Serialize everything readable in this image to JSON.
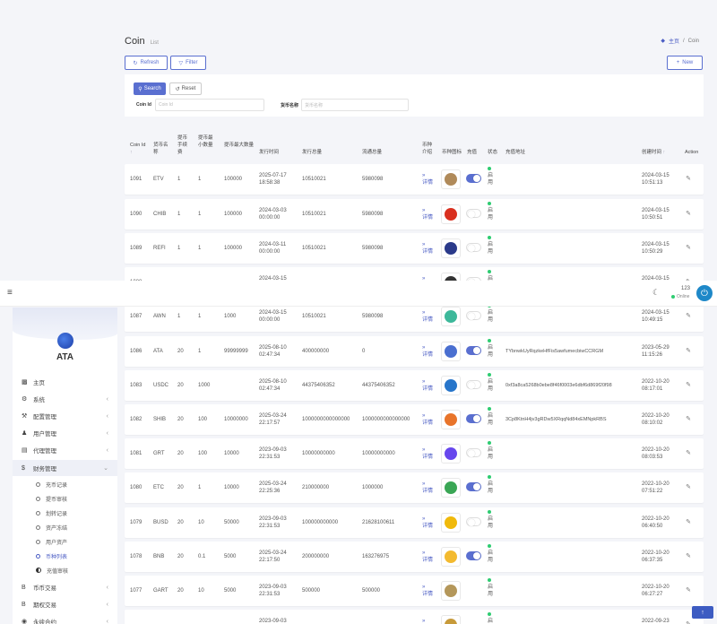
{
  "page": {
    "title": "Coin",
    "subtitle": "List"
  },
  "breadcrumb": {
    "home": "主页",
    "current": "Coin"
  },
  "toolbar": {
    "refresh": "Refresh",
    "filter": "Filter",
    "new": "New"
  },
  "filter": {
    "search": "Search",
    "reset": "Reset",
    "coin_id_label": "Coin Id",
    "coin_id_placeholder": "Coin Id",
    "name_label": "货币名称",
    "name_placeholder": "货币名称"
  },
  "table": {
    "headers": {
      "coin_id": "Coin Id",
      "name": "货币名称",
      "fee": "提币手续费",
      "min": "提币最小数量",
      "max": "提币最大数量",
      "issue_time": "发行时间",
      "issue_total": "发行总量",
      "circulation": "流通总量",
      "intro": "币种介绍",
      "icon": "币种图标",
      "deposit": "充值",
      "status": "状态",
      "address": "充值地址",
      "created": "创建时间",
      "action": "Action"
    },
    "detail_label": "详情",
    "status_label": "启用",
    "rows": [
      {
        "id": "1091",
        "name": "ETV",
        "fee": "1",
        "min": "1",
        "max": "100000",
        "issue": "2025-07-17 18:58:38",
        "total": "10510021",
        "circ": "5980098",
        "address": "",
        "created": "2024-03-15 10:51:13",
        "deposit": "on"
      },
      {
        "id": "1090",
        "name": "CHIB",
        "fee": "1",
        "min": "1",
        "max": "100000",
        "issue": "2024-03-03 00:00:00",
        "total": "10510021",
        "circ": "5980098",
        "address": "",
        "created": "2024-03-15 10:50:51",
        "deposit": "off"
      },
      {
        "id": "1089",
        "name": "REFI",
        "fee": "1",
        "min": "1",
        "max": "100000",
        "issue": "2024-03-11 00:00:00",
        "total": "10510021",
        "circ": "5980098",
        "address": "",
        "created": "2024-03-15 10:50:29",
        "deposit": "off"
      },
      {
        "id": "1088",
        "name": "",
        "fee": "",
        "min": "",
        "max": "",
        "issue": "2024-03-15",
        "total": "",
        "circ": "",
        "address": "",
        "created": "2024-03-15",
        "deposit": "off"
      },
      {
        "id": "1087",
        "name": "AWN",
        "fee": "1",
        "min": "1",
        "max": "1000",
        "issue": "2024-03-15 00:00:00",
        "total": "10510021",
        "circ": "5980098",
        "address": "",
        "created": "2024-03-15 10:49:15",
        "deposit": "off"
      },
      {
        "id": "1086",
        "name": "ATA",
        "fee": "20",
        "min": "1",
        "max": "99999999",
        "issue": "2025-08-10 02:47:34",
        "total": "400000000",
        "circ": "0",
        "address": "TYbnwkUyRqzkeHfFis5awfumecbiwCCRGM",
        "created": "2023-05-29 11:15:26",
        "deposit": "on"
      },
      {
        "id": "1083",
        "name": "USDC",
        "fee": "20",
        "min": "1000",
        "max": "",
        "issue": "2025-08-10 02:47:34",
        "total": "44375406352",
        "circ": "44375406352",
        "address": "0xf3a8ca5268b0ebe8f46f0003e6dbf6d869f20f98",
        "created": "2022-10-20 08:17:01",
        "deposit": "off"
      },
      {
        "id": "1082",
        "name": "SHIB",
        "fee": "20",
        "min": "100",
        "max": "10000000",
        "issue": "2025-03-24 22:17:57",
        "total": "1000000000000000",
        "circ": "1000000000000000",
        "address": "3Cp8KtnH4jv3gRDw5XRqqNd84xEMNpkRBS",
        "created": "2022-10-20 08:10:02",
        "deposit": "on"
      },
      {
        "id": "1081",
        "name": "GRT",
        "fee": "20",
        "min": "100",
        "max": "10000",
        "issue": "2023-09-03 22:31:53",
        "total": "10000000000",
        "circ": "10000000000",
        "address": "",
        "created": "2022-10-20 08:03:53",
        "deposit": "off"
      },
      {
        "id": "1080",
        "name": "ETC",
        "fee": "20",
        "min": "1",
        "max": "10000",
        "issue": "2025-03-24 22:25:36",
        "total": "210000000",
        "circ": "1000000",
        "address": "",
        "created": "2022-10-20 07:51:22",
        "deposit": "on"
      },
      {
        "id": "1079",
        "name": "BUSD",
        "fee": "20",
        "min": "10",
        "max": "50000",
        "issue": "2023-09-03 22:31:53",
        "total": "100000000000",
        "circ": "21628100611",
        "address": "",
        "created": "2022-10-20 06:40:50",
        "deposit": "off"
      },
      {
        "id": "1078",
        "name": "BNB",
        "fee": "20",
        "min": "0.1",
        "max": "5000",
        "issue": "2025-03-24 22:17:50",
        "total": "200000000",
        "circ": "163276975",
        "address": "",
        "created": "2022-10-20 06:37:35",
        "deposit": "on"
      },
      {
        "id": "1077",
        "name": "GART",
        "fee": "20",
        "min": "10",
        "max": "5000",
        "issue": "2023-09-03 22:31:53",
        "total": "500000",
        "circ": "500000",
        "address": "",
        "created": "2022-10-20 06:27:27",
        "deposit": "none"
      },
      {
        "id": "",
        "name": "",
        "fee": "",
        "min": "",
        "max": "",
        "issue": "2023-09-03",
        "total": "",
        "circ": "",
        "address": "",
        "created": "2022-09-23",
        "deposit": "none"
      }
    ]
  },
  "topbar": {
    "user": "123",
    "online": "Online"
  },
  "sidebar": {
    "brand": "ATA",
    "items": [
      "主页",
      "系统",
      "配置管理",
      "用户管理",
      "代理管理",
      "财务管理"
    ],
    "sub_items": [
      "充币记录",
      "提币审核",
      "划转记录",
      "资产冻结",
      "用户资产",
      "币种列表",
      "充值审核"
    ],
    "bottom_items": [
      "币币交易",
      "期权交易",
      "永续合约"
    ]
  },
  "colors": {
    "accent": "#5a6fd0",
    "link": "#4a5cc4",
    "online": "#2ecc71",
    "power": "#1e88c8"
  }
}
